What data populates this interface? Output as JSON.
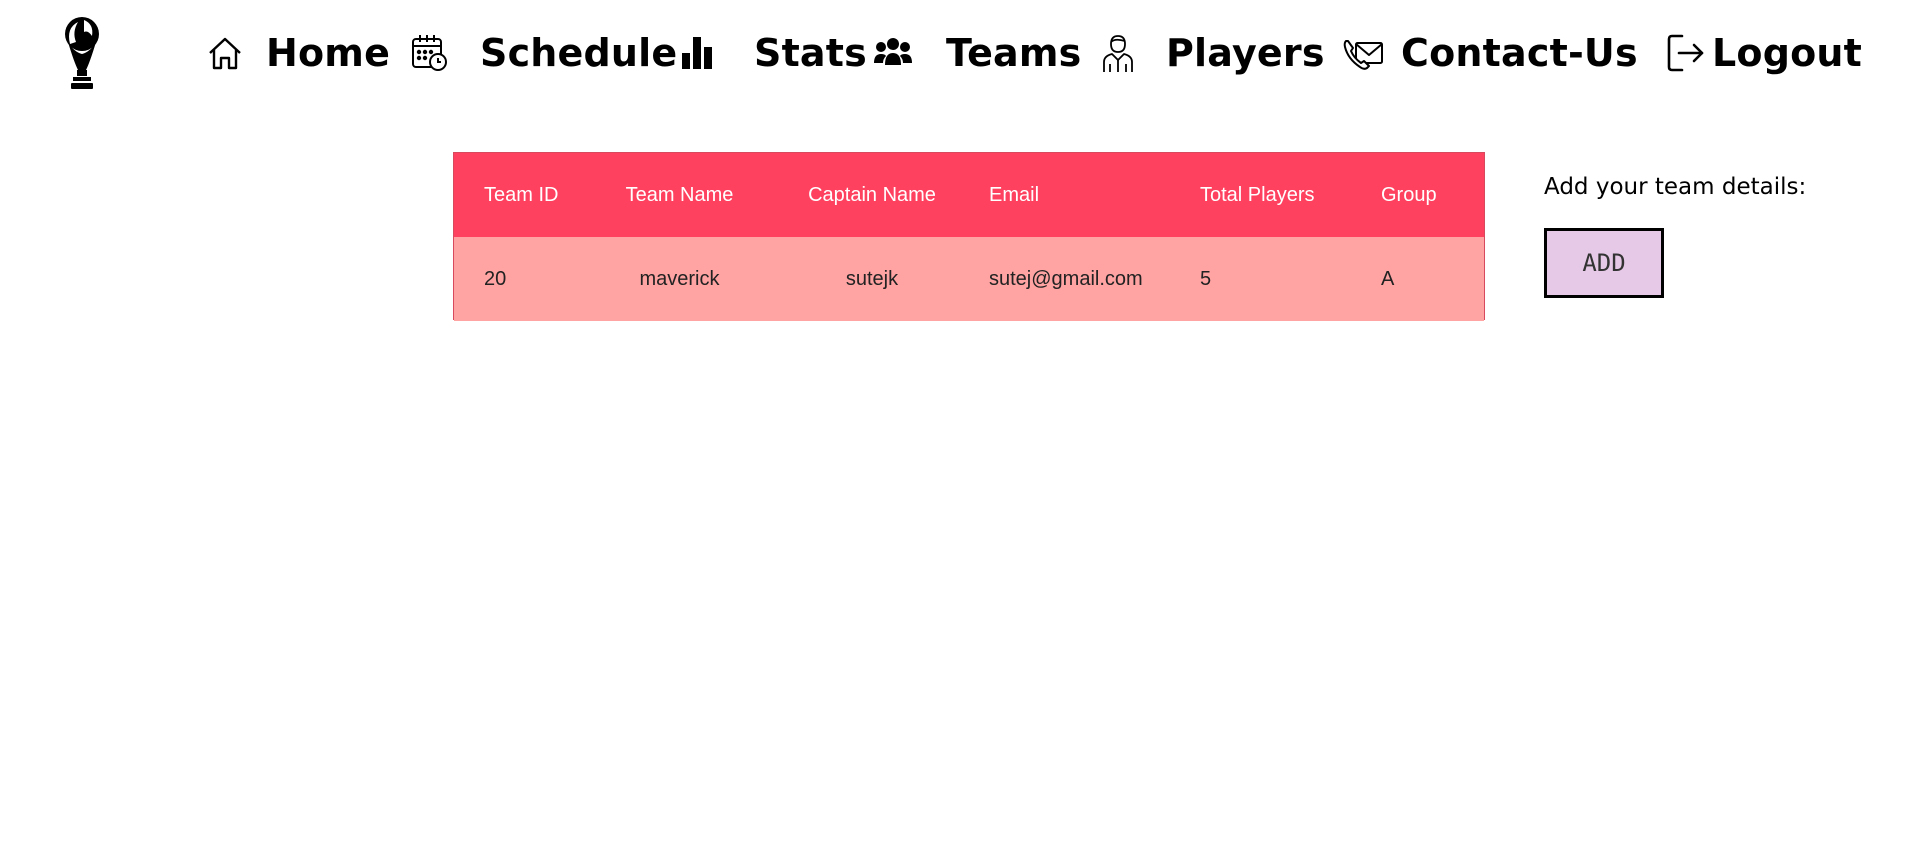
{
  "nav": {
    "logo_icon": "world-cup-trophy-icon",
    "items": [
      {
        "label": "Home",
        "icon": "house-icon"
      },
      {
        "label": "Schedule",
        "icon": "calendar-clock-icon"
      },
      {
        "label": "Stats",
        "icon": "bar-chart-icon"
      },
      {
        "label": "Teams",
        "icon": "users-group-icon"
      },
      {
        "label": "Players",
        "icon": "player-icon"
      },
      {
        "label": "Contact-Us",
        "icon": "phone-mail-icon"
      },
      {
        "label": "Logout",
        "icon": "logout-icon"
      }
    ]
  },
  "table": {
    "headers": [
      "Team ID",
      "Team Name",
      "Captain Name",
      "Email",
      "Total Players",
      "Group"
    ],
    "rows": [
      [
        "20",
        "maverick",
        "sutejk",
        "sutej@gmail.com",
        "5",
        "A"
      ]
    ],
    "header_bg": "#ff4160",
    "row_bg": "#ffa3a3"
  },
  "side": {
    "prompt": "Add your team details:",
    "add_label": "ADD",
    "add_bg": "#e6c9e6"
  }
}
